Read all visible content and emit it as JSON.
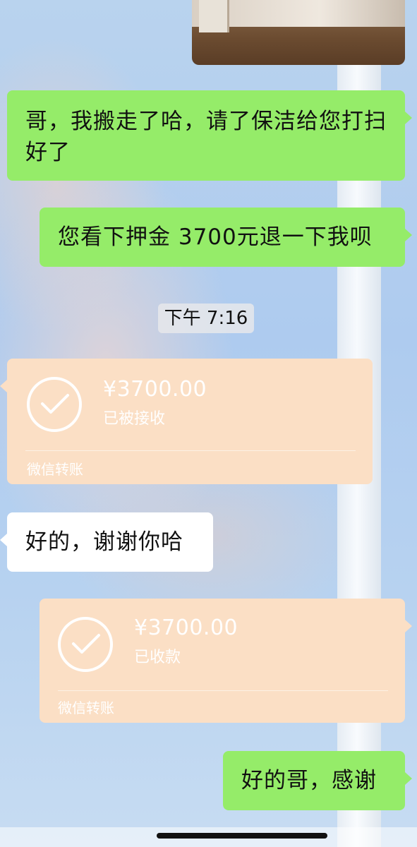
{
  "messages": {
    "m1": "哥，我搬走了哈，请了保洁给您打扫好了",
    "m2": "您看下押金 3700元退一下我呗",
    "time": "下午 7:16",
    "t1": {
      "amount": "¥3700.00",
      "status": "已被接收",
      "footer": "微信转账"
    },
    "m3": "好的，谢谢你哈",
    "t2": {
      "amount": "¥3700.00",
      "status": "已收款",
      "footer": "微信转账"
    },
    "m4": "好的哥，感谢"
  },
  "colors": {
    "sent_bubble": "#95ec69",
    "received_bubble": "#ffffff",
    "transfer_card": "#fbdfc5"
  }
}
